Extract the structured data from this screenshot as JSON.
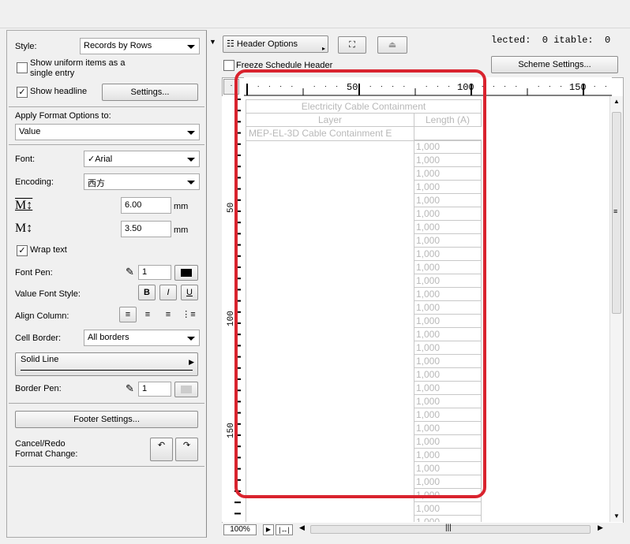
{
  "left_panel": {
    "style_label": "Style:",
    "style_value": "Records by Rows",
    "uniform_label": "Show uniform items as a single entry",
    "uniform_checked": false,
    "headline_label": "Show headline",
    "headline_checked": true,
    "settings_btn": "Settings...",
    "apply_label": "Apply Format Options to:",
    "apply_value": "Value",
    "font_label": "Font:",
    "font_value": "✓Arial",
    "encoding_label": "Encoding:",
    "encoding_value": "西方",
    "size1_value": "6.00",
    "size1_unit": "mm",
    "size2_value": "3.50",
    "size2_unit": "mm",
    "wrap_label": "Wrap text",
    "wrap_checked": true,
    "fontpen_label": "Font Pen:",
    "fontpen_value": "1",
    "valuestyle_label": "Value Font Style:",
    "bold": "B",
    "italic": "I",
    "underline": "U",
    "align_label": "Align Column:",
    "border_label": "Cell Border:",
    "border_value": "All borders",
    "line_value": "Solid Line",
    "borderpen_label": "Border Pen:",
    "borderpen_value": "1",
    "footer_btn": "Footer Settings...",
    "cancel_label": "Cancel/Redo\nFormat Change:"
  },
  "toolbar": {
    "header_options": "Header Options",
    "freeze_label": "Freeze Schedule Header",
    "selected_text": "lected:  0 itable:  0",
    "scheme_settings": "Scheme Settings..."
  },
  "ruler": {
    "h_labels": [
      "50",
      "100",
      "150"
    ],
    "v_labels": [
      "50",
      "100",
      "150"
    ]
  },
  "schedule": {
    "title": "Electricity Cable Containment",
    "headers": [
      "Layer",
      "Length (A)"
    ],
    "layer_value": "MEP-EL-3D Cable Containment E",
    "length_values": [
      "1,000",
      "1,000",
      "1,000",
      "1,000",
      "1,000",
      "1,000",
      "1,000",
      "1,000",
      "1,000",
      "1,000",
      "1,000",
      "1,000",
      "1,000",
      "1,000",
      "1,000",
      "1,000",
      "1,000",
      "1,000",
      "1,000",
      "1,000",
      "1,000",
      "1,000",
      "1,000",
      "1,000",
      "1,000",
      "1,000",
      "1,000",
      "1,000",
      "1,000"
    ]
  },
  "footer": {
    "zoom": "100%"
  }
}
